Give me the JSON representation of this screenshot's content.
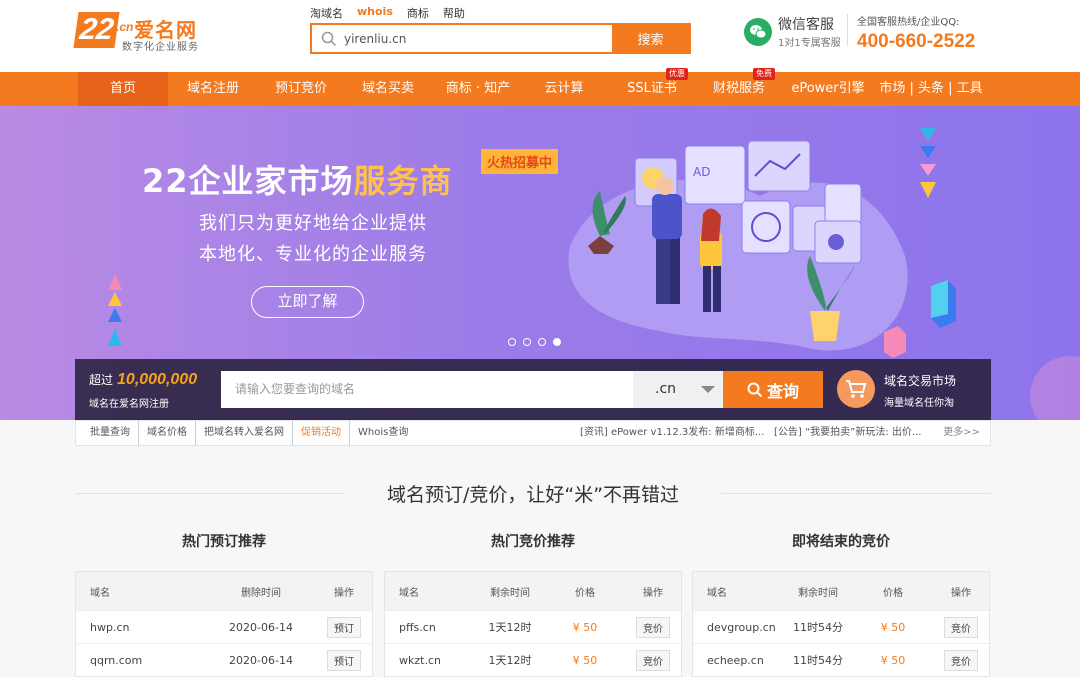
{
  "header": {
    "logo_number": "22",
    "logo_cn": ".cn",
    "logo_brand": "爱名网",
    "logo_slogan": "数字化企业服务",
    "search_tabs": [
      "淘域名",
      "whois",
      "商标",
      "帮助"
    ],
    "search_active_tab": "whois",
    "search_value": "yirenliu.cn",
    "search_button": "搜索",
    "wechat_title": "微信客服",
    "wechat_sub": "1对1专属客服",
    "hotline_label": "全国客服热线/企业QQ:",
    "hotline_number": "400-660-2522"
  },
  "nav": {
    "items": [
      {
        "label": "首页",
        "active": true
      },
      {
        "label": "域名注册"
      },
      {
        "label": "预订竞价"
      },
      {
        "label": "域名买卖"
      },
      {
        "label": "商标 · 知产"
      },
      {
        "label": "云计算"
      },
      {
        "label": "SSL证书",
        "badge": "优惠"
      },
      {
        "label": "财税服务",
        "badge": "免费"
      },
      {
        "label": "ePower引擎"
      },
      {
        "label": "市场 | 头条 | 工具"
      }
    ]
  },
  "banner": {
    "title_prefix": "22企业家市场",
    "title_highlight": "服务商",
    "tag": "火热招募中",
    "subtitle_line1": "我们只为更好地给企业提供",
    "subtitle_line2": "本地化、专业化的企业服务",
    "cta": "立即了解",
    "slides": 4,
    "active_slide": 4
  },
  "domain_search": {
    "count_prefix": "超过",
    "count": "10,000,000",
    "count_sub": "域名在爱名网注册",
    "placeholder": "请输入您要查询的域名",
    "suffix": ".cn",
    "button": "查询",
    "market_title": "域名交易市场",
    "market_sub": "海量域名任你淘"
  },
  "quick_links": {
    "links": [
      "批量查询",
      "域名价格",
      "把域名转入爱名网",
      "促销活动",
      "Whois查询"
    ],
    "hot_link": "促销活动",
    "news1": "[资讯] ePower v1.12.3发布: 新增商标...",
    "news2": "[公告] “我要拍卖”新玩法: 出价...",
    "more": "更多>>"
  },
  "section_title": "域名预订/竞价，让好“米”不再错过",
  "columns": [
    {
      "title": "热门预订推荐",
      "headers": [
        "域名",
        "删除时间",
        "操作"
      ],
      "rows": [
        [
          "hwp.cn",
          "2020-06-14",
          "预订"
        ],
        [
          "qqrn.com",
          "2020-06-14",
          "预订"
        ]
      ]
    },
    {
      "title": "热门竞价推荐",
      "headers": [
        "域名",
        "剩余时间",
        "价格",
        "操作"
      ],
      "rows": [
        [
          "pffs.cn",
          "1天12时",
          "¥ 50",
          "竞价"
        ],
        [
          "wkzt.cn",
          "1天12时",
          "¥ 50",
          "竞价"
        ]
      ]
    },
    {
      "title": "即将结束的竞价",
      "headers": [
        "域名",
        "剩余时间",
        "价格",
        "操作"
      ],
      "rows": [
        [
          "devgroup.cn",
          "11时54分",
          "¥ 50",
          "竞价"
        ],
        [
          "echeep.cn",
          "11时54分",
          "¥ 50",
          "竞价"
        ]
      ]
    }
  ],
  "colors": {
    "brand_orange": "#f37a1f",
    "banner_purple": "#9b7ce8",
    "wechat_green": "#2aae67"
  }
}
